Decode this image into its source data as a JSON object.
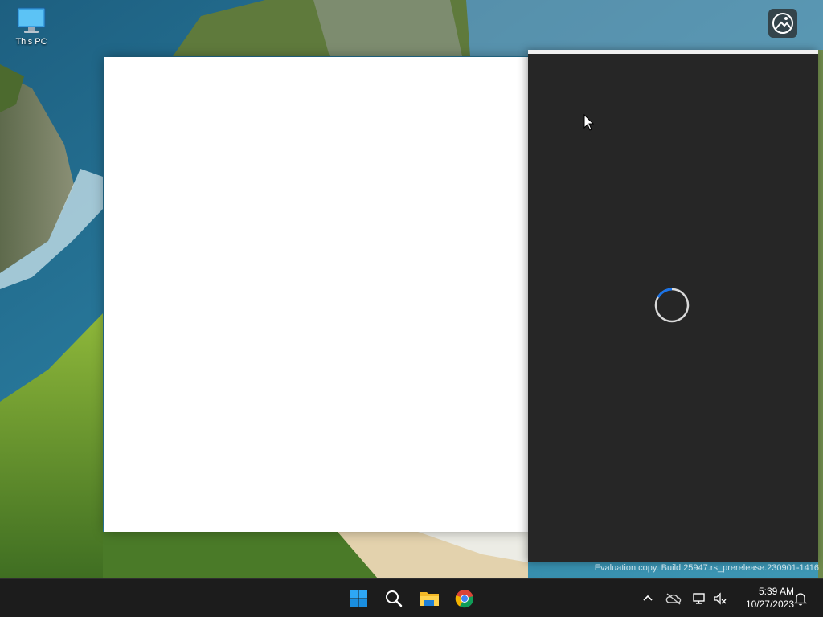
{
  "desktop": {
    "icons": [
      {
        "label": "This PC",
        "icon": "monitor-icon"
      }
    ],
    "watermark": "Evaluation copy. Build 25947.rs_prerelease.230901-1416"
  },
  "corner_button": {
    "icon": "photos-icon"
  },
  "dark_panel": {
    "state": "loading",
    "spinner_color": "#1a73e8"
  },
  "taskbar": {
    "pinned": [
      {
        "name": "start",
        "icon": "windows-logo-icon"
      },
      {
        "name": "search",
        "icon": "search-icon"
      },
      {
        "name": "file-explorer",
        "icon": "folder-icon"
      },
      {
        "name": "chrome",
        "icon": "chrome-icon"
      }
    ],
    "tray": [
      {
        "name": "show-hidden-icons",
        "icon": "chevron-up-icon"
      },
      {
        "name": "onedrive",
        "icon": "cloud-off-icon"
      },
      {
        "name": "network",
        "icon": "network-icon"
      },
      {
        "name": "volume",
        "icon": "volume-muted-icon"
      }
    ],
    "clock": {
      "time": "5:39 AM",
      "date": "10/27/2023"
    },
    "notifications": {
      "icon": "bell-icon"
    }
  },
  "colors": {
    "taskbar_bg": "#1c1c1c",
    "panel_bg": "#262626",
    "window_bg": "#ffffff",
    "accent": "#1a73e8"
  }
}
